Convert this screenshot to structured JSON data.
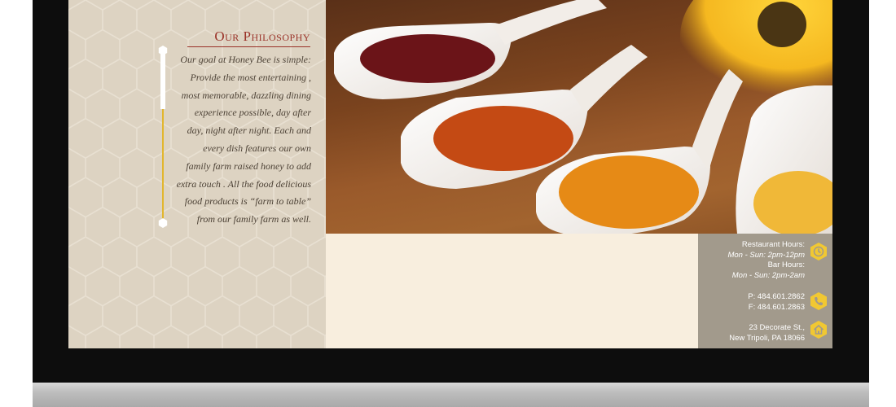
{
  "philosophy": {
    "title": "Our Philosophy",
    "lines": [
      "Our goal at Honey Bee is simple:",
      "Provide the most entertaining ,",
      "most memorable, dazzling dining",
      "experience possible, day after",
      "day, night after night.  Each and",
      "every dish features our own",
      "family farm raised honey to add",
      "extra touch . All the food delicious",
      "food products is “farm to table”",
      "from our family farm as well."
    ]
  },
  "info": {
    "restaurant_hours_label": "Restaurant Hours:",
    "restaurant_hours": "Mon - Sun: 2pm-12pm",
    "bar_hours_label": "Bar Hours:",
    "bar_hours": "Mon - Sun: 2pm-2am",
    "phone": "P: 484.601.2862",
    "fax": "F: 484.601.2863",
    "address_line1": "23 Decorate St.,",
    "address_line2": "New Tripoli, PA 18066"
  },
  "icons": {
    "hours": "clock-icon",
    "phone": "phone-icon",
    "address": "home-icon"
  },
  "colors": {
    "accent": "#9a3228",
    "honey": "#e2b62e",
    "icon_bg": "#f1c832"
  }
}
